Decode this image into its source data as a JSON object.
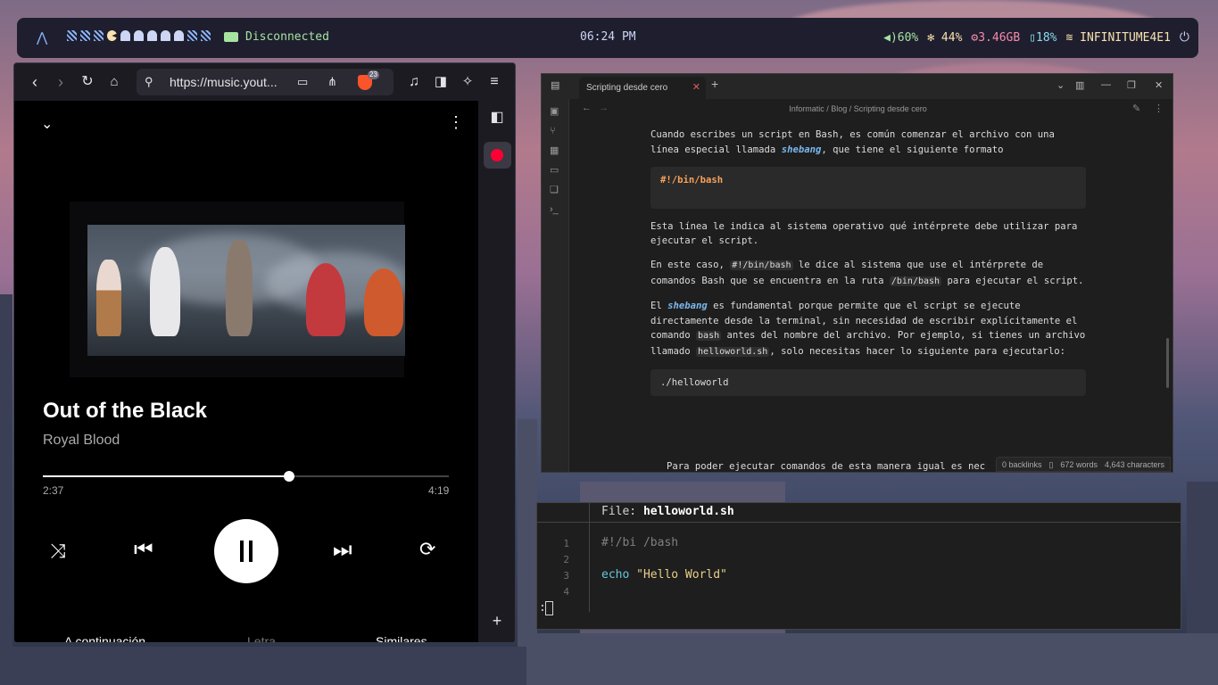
{
  "topbar": {
    "launcher_icon": "arch-logo",
    "workspaces": [
      "a",
      "a",
      "a",
      "p",
      "g",
      "g",
      "g",
      "g",
      "g",
      "a",
      "a"
    ],
    "vpn_status": "Disconnected",
    "clock": "06:24 PM",
    "volume": "60%",
    "cpu": "44%",
    "memory": "3.46GB",
    "battery": "18%",
    "wifi": "INFINITUME4E1",
    "power_icon": "power-icon"
  },
  "browser": {
    "url": "https://music.yout...",
    "brave_badge": "23",
    "player": {
      "title": "Out of the Black",
      "artist": "Royal Blood",
      "current_time": "2:37",
      "total_time": "4:19",
      "progress_fraction": 0.606,
      "tabs": [
        "A continuación",
        "Letra",
        "Similares"
      ]
    }
  },
  "obsidian": {
    "tab_title": "Scripting desde cero",
    "breadcrumb": [
      "Informatic",
      "Blog",
      "Scripting desde cero"
    ],
    "p1_a": "Cuando escribes un script en Bash, es común comenzar el archivo con una línea especial llamada ",
    "p1_em": "shebang",
    "p1_b": ", que tiene el siguiente formato",
    "code1": "#!/bin/bash",
    "p2": "Esta línea le indica al sistema operativo qué intérprete debe utilizar para ejecutar el script.",
    "p3_a": "En este caso, ",
    "p3_code1": "#!/bin/bash",
    "p3_b": " le dice al sistema que use el intérprete de comandos Bash que se encuentra en la ruta ",
    "p3_code2": "/bin/bash",
    "p3_c": " para ejecutar el script.",
    "p4_a": "El ",
    "p4_em": "shebang",
    "p4_b": " es fundamental porque permite que el script se ejecute directamente desde la terminal, sin necesidad de escribir explícitamente el comando ",
    "p4_code1": "bash",
    "p4_c": " antes del nombre del archivo. Por ejemplo, si tienes un archivo llamado ",
    "p4_code2": "helloworld.sh",
    "p4_d": ", solo necesitas hacer lo siguiente para ejecutarlo:",
    "code2": "./helloworld",
    "last_line": "Para poder ejecutar comandos de esta manera igual es nec",
    "status": {
      "backlinks": "0 backlinks",
      "words": "672 words",
      "characters": "4,643 characters"
    }
  },
  "terminal": {
    "file_label": "File: ",
    "file_name": "helloworld.sh",
    "lines": [
      {
        "n": "1",
        "text": "#!/bi /bash"
      },
      {
        "n": "2",
        "text": ""
      },
      {
        "n": "3",
        "cmd": "echo",
        "str": "\"Hello World\""
      },
      {
        "n": "4",
        "text": ""
      }
    ],
    "prompt": ":"
  },
  "colors": {
    "bar_bg": "#1e1e2e",
    "vpn_green": "#a6e3a1",
    "cpu_yellow": "#f9e2af",
    "mem_pink": "#f38ba8",
    "battery_cyan": "#89dceb",
    "obsidian_link": "#7ab8ee",
    "code_keyword": "#f6a05a"
  }
}
